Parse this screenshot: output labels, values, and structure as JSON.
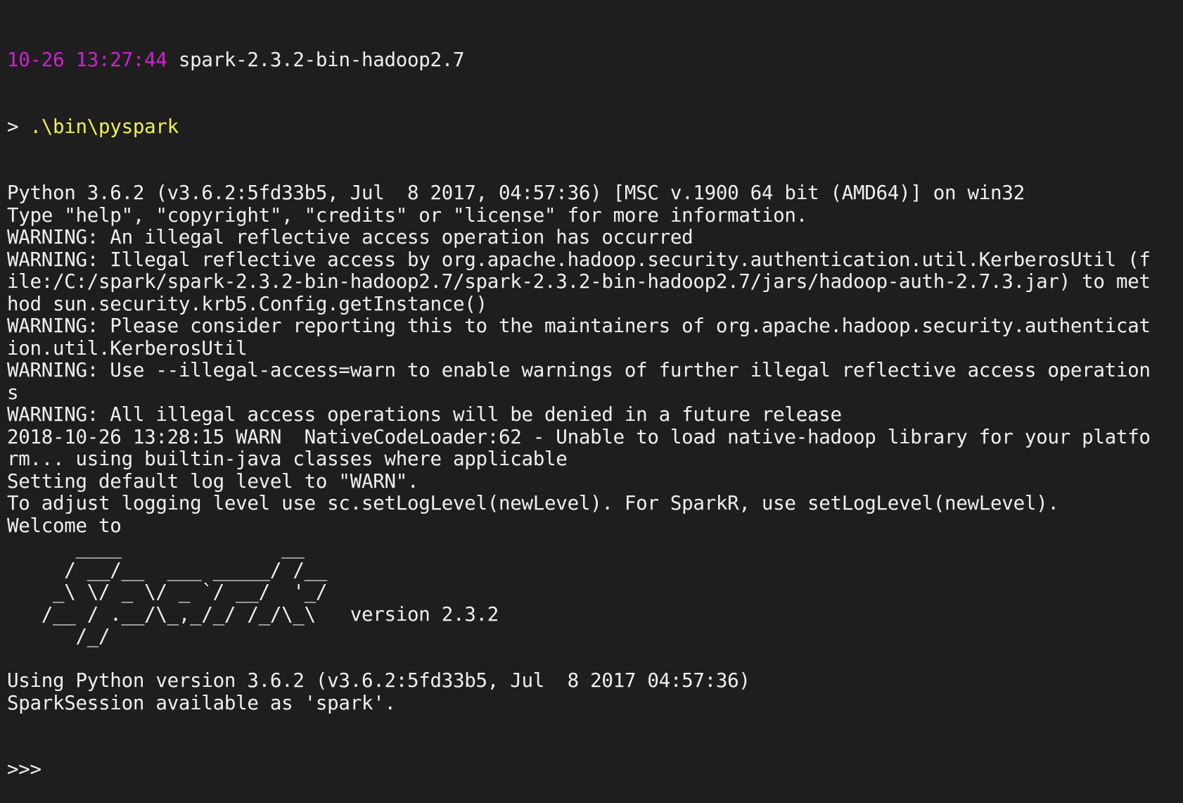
{
  "session": {
    "timestamp": "10-26 13:27:44",
    "cwd": " spark-2.3.2-bin-hadoop2.7",
    "prompt_symbol": "> ",
    "command": ".\\bin\\pyspark"
  },
  "output_lines": [
    "Python 3.6.2 (v3.6.2:5fd33b5, Jul  8 2017, 04:57:36) [MSC v.1900 64 bit (AMD64)] on win32",
    "Type \"help\", \"copyright\", \"credits\" or \"license\" for more information.",
    "WARNING: An illegal reflective access operation has occurred",
    "WARNING: Illegal reflective access by org.apache.hadoop.security.authentication.util.KerberosUtil (f",
    "ile:/C:/spark/spark-2.3.2-bin-hadoop2.7/spark-2.3.2-bin-hadoop2.7/jars/hadoop-auth-2.7.3.jar) to met",
    "hod sun.security.krb5.Config.getInstance()",
    "WARNING: Please consider reporting this to the maintainers of org.apache.hadoop.security.authenticat",
    "ion.util.KerberosUtil",
    "WARNING: Use --illegal-access=warn to enable warnings of further illegal reflective access operation",
    "s",
    "WARNING: All illegal access operations will be denied in a future release",
    "2018-10-26 13:28:15 WARN  NativeCodeLoader:62 - Unable to load native-hadoop library for your platfo",
    "rm... using builtin-java classes where applicable",
    "Setting default log level to \"WARN\".",
    "To adjust logging level use sc.setLogLevel(newLevel). For SparkR, use setLogLevel(newLevel).",
    "Welcome to",
    "      ____              __",
    "     / __/__  ___ _____/ /__",
    "    _\\ \\/ _ \\/ _ `/ __/  '_/",
    "   /__ / .__/\\_,_/_/ /_/\\_\\   version 2.3.2",
    "      /_/",
    "",
    "Using Python version 3.6.2 (v3.6.2:5fd33b5, Jul  8 2017 04:57:36)",
    "SparkSession available as 'spark'."
  ],
  "repl_prompt": ">>>",
  "colors": {
    "background": "#1e1e1e",
    "foreground": "#f0f0f0",
    "timestamp": "#d020d0",
    "command": "#f0f050"
  }
}
